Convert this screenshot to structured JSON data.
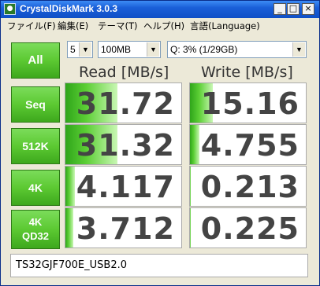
{
  "window": {
    "title": "CrystalDiskMark 3.0.3",
    "icon": "disk-icon"
  },
  "titlebar_buttons": [
    "minimize-icon",
    "maximize-icon",
    "close-icon"
  ],
  "menu": [
    "ファイル(F)",
    "編集(E)",
    "テーマ(T)",
    "ヘルプ(H)",
    "言語(Language)"
  ],
  "controls": {
    "all_label": "All",
    "runs": "5",
    "size": "100MB",
    "drive": "Q: 3% (1/29GB)"
  },
  "headers": {
    "read": "Read [MB/s]",
    "write": "Write [MB/s]"
  },
  "tests": [
    {
      "label": "Seq",
      "label2": "",
      "read": "31.72",
      "write": "15.16",
      "read_fill": 0.45,
      "write_fill": 0.2
    },
    {
      "label": "512K",
      "label2": "",
      "read": "31.32",
      "write": "4.755",
      "read_fill": 0.45,
      "write_fill": 0.08
    },
    {
      "label": "4K",
      "label2": "",
      "read": "4.117",
      "write": "0.213",
      "read_fill": 0.08,
      "write_fill": 0.01
    },
    {
      "label": "4K",
      "label2": "QD32",
      "read": "3.712",
      "write": "0.225",
      "read_fill": 0.07,
      "write_fill": 0.01
    }
  ],
  "comment": "TS32GJF700E_USB2.0",
  "colors": {
    "bar_dark": "#2fa51a",
    "bar_light": "#c9f7b4",
    "titlebar": "#1a5fd8"
  }
}
